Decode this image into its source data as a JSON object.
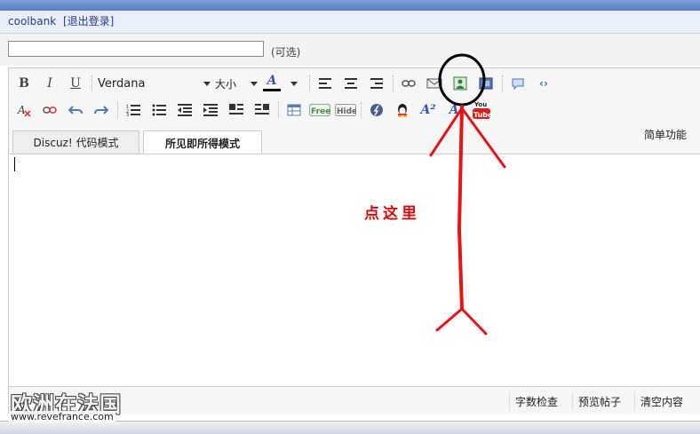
{
  "userbar": {
    "username": "coolbank",
    "logout": "[退出登录]"
  },
  "title_row": {
    "value": "",
    "optional_label": "(可选)"
  },
  "toolbar": {
    "bold": "B",
    "italic": "I",
    "underline": "U",
    "font_family": "Verdana",
    "font_size": "大小",
    "font_color_glyph": "A",
    "superscript_glyph": "A²"
  },
  "tabs": [
    {
      "label": "Discuz! 代码模式",
      "active": false
    },
    {
      "label": "所见即所得模式",
      "active": true
    }
  ],
  "simple_mode": "简单功能",
  "status_buttons": {
    "word_count": "字数检查",
    "preview": "预览帖子",
    "clear": "清空内容"
  },
  "annotation": {
    "text": "点这里",
    "color": "#d30c0c"
  },
  "watermark": {
    "brand": "欧洲在法国",
    "url": "www.revefrance.com"
  },
  "colors": {
    "accent": "#5b7ec4",
    "link": "#24408f",
    "annotation": "#d30c0c"
  }
}
